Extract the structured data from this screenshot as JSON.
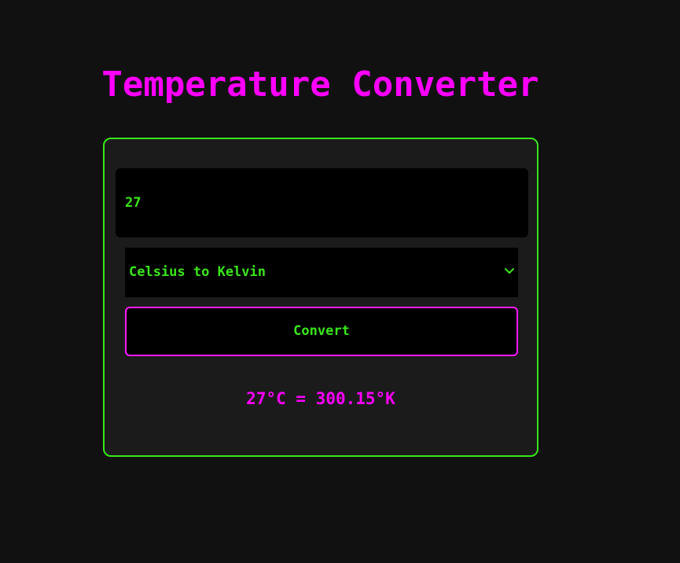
{
  "app": {
    "title": "Temperature Converter"
  },
  "form": {
    "input_value": "27",
    "conversion_selected": "Celsius to Kelvin",
    "convert_label": "Convert"
  },
  "result": {
    "text": "27°C = 300.15°K"
  },
  "colors": {
    "background": "#111111",
    "card_background": "#1b1b1b",
    "accent_green": "#39e61a",
    "accent_magenta": "#ff00ff",
    "field_background": "#000000"
  },
  "icons": {
    "select_arrow": "chevron-down-icon"
  }
}
